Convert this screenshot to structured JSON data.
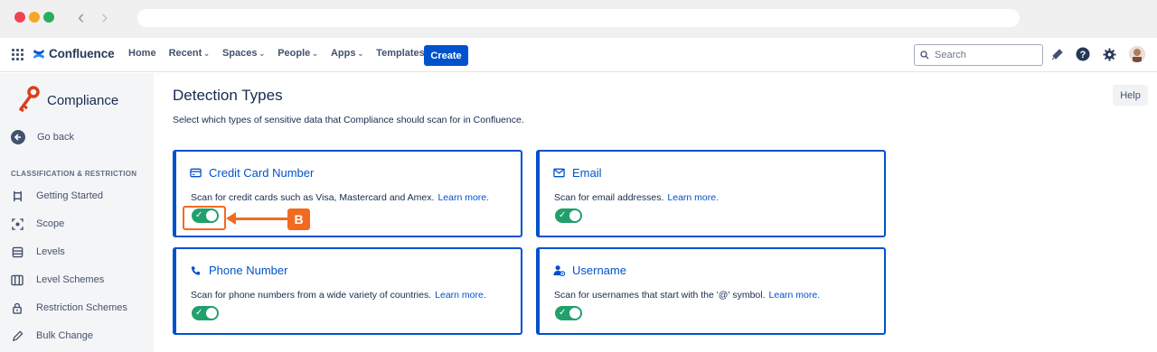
{
  "nav": {
    "logo": "Confluence",
    "items": [
      {
        "label": "Home",
        "dropdown": false
      },
      {
        "label": "Recent",
        "dropdown": true
      },
      {
        "label": "Spaces",
        "dropdown": true
      },
      {
        "label": "People",
        "dropdown": true
      },
      {
        "label": "Apps",
        "dropdown": true
      },
      {
        "label": "Templates",
        "dropdown": false
      }
    ],
    "create_label": "Create",
    "search_placeholder": "Search"
  },
  "sidebar": {
    "app_title": "Compliance",
    "go_back": "Go back",
    "section": "CLASSIFICATION & RESTRICTION",
    "items": [
      {
        "label": "Getting Started",
        "icon": "flag-icon"
      },
      {
        "label": "Scope",
        "icon": "scope-icon"
      },
      {
        "label": "Levels",
        "icon": "levels-icon"
      },
      {
        "label": "Level Schemes",
        "icon": "level-schemes-icon"
      },
      {
        "label": "Restriction Schemes",
        "icon": "lock-icon"
      },
      {
        "label": "Bulk Change",
        "icon": "pencil-icon"
      }
    ]
  },
  "main": {
    "title": "Detection Types",
    "description": "Select which types of sensitive data that Compliance should scan for in Confluence.",
    "help_label": "Help",
    "cards": [
      {
        "title": "Credit Card Number",
        "icon": "credit-card-icon",
        "desc": "Scan for credit cards such as Visa, Mastercard and Amex.",
        "link": "Learn more.",
        "enabled": true
      },
      {
        "title": "Email",
        "icon": "envelope-icon",
        "desc": "Scan for email addresses.",
        "link": "Learn more.",
        "enabled": true
      },
      {
        "title": "Phone Number",
        "icon": "phone-icon",
        "desc": "Scan for phone numbers from a wide variety of countries.",
        "link": "Learn more.",
        "enabled": true
      },
      {
        "title": "Username",
        "icon": "user-icon",
        "desc": "Scan for usernames that start with the '@' symbol.",
        "link": "Learn more.",
        "enabled": true
      }
    ]
  },
  "annotation": {
    "badge": "B",
    "color": "#f26a21"
  },
  "colors": {
    "accent": "#0052cc",
    "toggle_on": "#22a06b"
  }
}
